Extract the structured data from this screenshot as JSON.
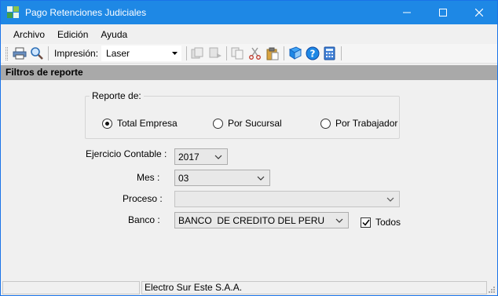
{
  "window": {
    "title": "Pago Retenciones Judiciales",
    "icon": "app-grid-icon",
    "accent_color": "#1e88e5"
  },
  "menu": {
    "items": [
      "Archivo",
      "Edición",
      "Ayuda"
    ]
  },
  "toolbar": {
    "impresion_label": "Impresión:",
    "impresion_value": "Laser"
  },
  "filter_header": "Filtros de reporte",
  "reporte": {
    "group_label": "Reporte de:",
    "options": [
      {
        "label": "Total Empresa",
        "checked": true
      },
      {
        "label": "Por Sucursal",
        "checked": false
      },
      {
        "label": "Por Trabajador",
        "checked": false
      }
    ]
  },
  "fields": {
    "ejercicio": {
      "label": "Ejercicio Contable :",
      "value": "2017"
    },
    "mes": {
      "label": "Mes :",
      "value": "03"
    },
    "proceso": {
      "label": "Proceso :",
      "value": ""
    },
    "banco": {
      "label": "Banco :",
      "value": "BANCO  DE CREDITO DEL PERU"
    }
  },
  "todos": {
    "label": "Todos",
    "checked": true
  },
  "status": {
    "panel1": "",
    "panel2": "Electro Sur Este S.A.A."
  }
}
